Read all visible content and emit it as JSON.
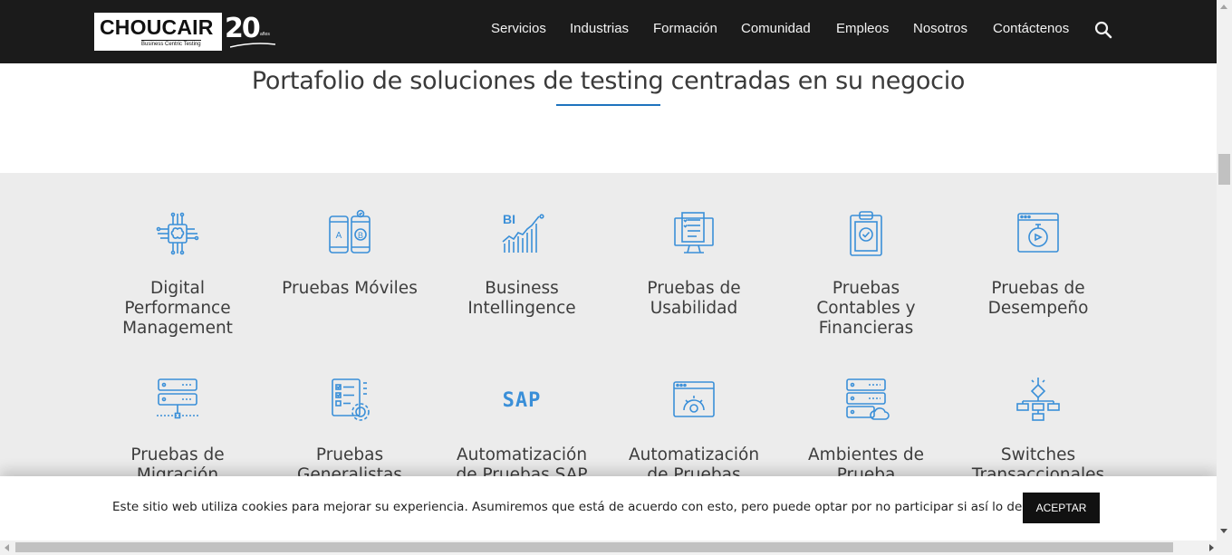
{
  "header": {
    "logo": {
      "word": "CHOUCAIR",
      "tagline": "Business Centric Testing",
      "anniversary": "20",
      "years": "años"
    },
    "nav": [
      "Servicios",
      "Industrias",
      "Formación",
      "Comunidad",
      "Empleos",
      "Nosotros",
      "Contáctenos"
    ],
    "search_icon": "search-icon"
  },
  "main": {
    "title": "Portafolio de soluciones de testing centradas en su negocio",
    "accent_color": "#1e73be",
    "icon_color": "#3a8fd8",
    "services": [
      {
        "icon": "brain-chip-icon",
        "label": "Digital Performance Management"
      },
      {
        "icon": "ab-mobile-icon",
        "label": "Pruebas Móviles"
      },
      {
        "icon": "bi-chart-icon",
        "label": "Business Intellingence"
      },
      {
        "icon": "usability-monitor-icon",
        "label": "Pruebas de Usabilidad"
      },
      {
        "icon": "clipboard-check-icon",
        "label": "Pruebas Contables y Financieras"
      },
      {
        "icon": "stopwatch-window-icon",
        "label": "Pruebas de Desempeño"
      },
      {
        "icon": "server-migration-icon",
        "label": "Pruebas de Migración"
      },
      {
        "icon": "checklist-gear-icon",
        "label": "Pruebas Generalistas"
      },
      {
        "icon": "sap-logo-icon",
        "label": "Automatización de Pruebas SAP"
      },
      {
        "icon": "browser-gear-icon",
        "label": "Automatización de Pruebas"
      },
      {
        "icon": "server-cloud-icon",
        "label": "Ambientes de Prueba"
      },
      {
        "icon": "flowchart-icon",
        "label": "Switches Transaccionales"
      }
    ]
  },
  "cookie_banner": {
    "text": "Este sitio web utiliza cookies para mejorar su experiencia. Asumiremos que está de acuerdo con esto, pero puede optar por no participar si así lo desea.",
    "button": "ACEPTAR"
  }
}
